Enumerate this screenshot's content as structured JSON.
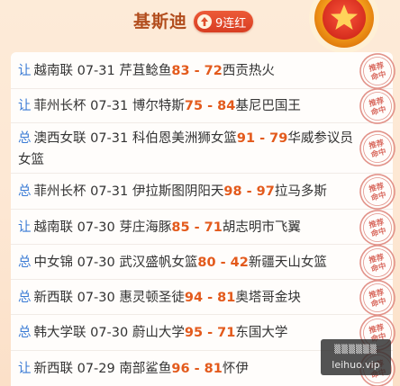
{
  "header": {
    "title": "基斯迪",
    "streak": "9连红"
  },
  "stamp_text": "推荐命中",
  "watermark": {
    "line1": "▒▒▒▒▒▒",
    "line2": "leihuo.vip"
  },
  "rows": [
    {
      "tag": "让",
      "league": "越南联",
      "date": "07-31",
      "home": "芹苴鲶鱼",
      "home_score": "83",
      "sep": " - ",
      "away_score": "72",
      "away": "西贡热火"
    },
    {
      "tag": "让",
      "league": "菲州长杯",
      "date": "07-31",
      "home": "博尔特斯",
      "home_score": "75",
      "sep": " - ",
      "away_score": "84",
      "away": "基尼巴国王"
    },
    {
      "tag": "总",
      "league": "澳西女联",
      "date": "07-31",
      "home": "科伯恩美洲狮女篮",
      "home_score": "91",
      "sep": " - ",
      "away_score": "79",
      "away": "华威参议员女篮"
    },
    {
      "tag": "总",
      "league": "菲州长杯",
      "date": "07-31",
      "home": "伊拉斯图阴阳天",
      "home_score": "98",
      "sep": " - ",
      "away_score": "97",
      "away": "拉马多斯"
    },
    {
      "tag": "让",
      "league": "越南联",
      "date": "07-30",
      "home": "芽庄海豚",
      "home_score": "85",
      "sep": " - ",
      "away_score": "71",
      "away": "胡志明市飞翼"
    },
    {
      "tag": "总",
      "league": "中女锦",
      "date": "07-30",
      "home": "武汉盛帆女篮",
      "home_score": "80",
      "sep": " - ",
      "away_score": "42",
      "away": "新疆天山女篮"
    },
    {
      "tag": "总",
      "league": "新西联",
      "date": "07-30",
      "home": "惠灵顿圣徒",
      "home_score": "94",
      "sep": " - ",
      "away_score": "81",
      "away": "奥塔哥金块"
    },
    {
      "tag": "总",
      "league": "韩大学联",
      "date": "07-30",
      "home": "蔚山大学",
      "home_score": "95",
      "sep": " - ",
      "away_score": "71",
      "away": "东国大学"
    },
    {
      "tag": "让",
      "league": "新西联",
      "date": "07-29",
      "home": "南部鲨鱼",
      "home_score": "96",
      "sep": " - ",
      "away_score": "81",
      "away": "怀伊"
    }
  ]
}
